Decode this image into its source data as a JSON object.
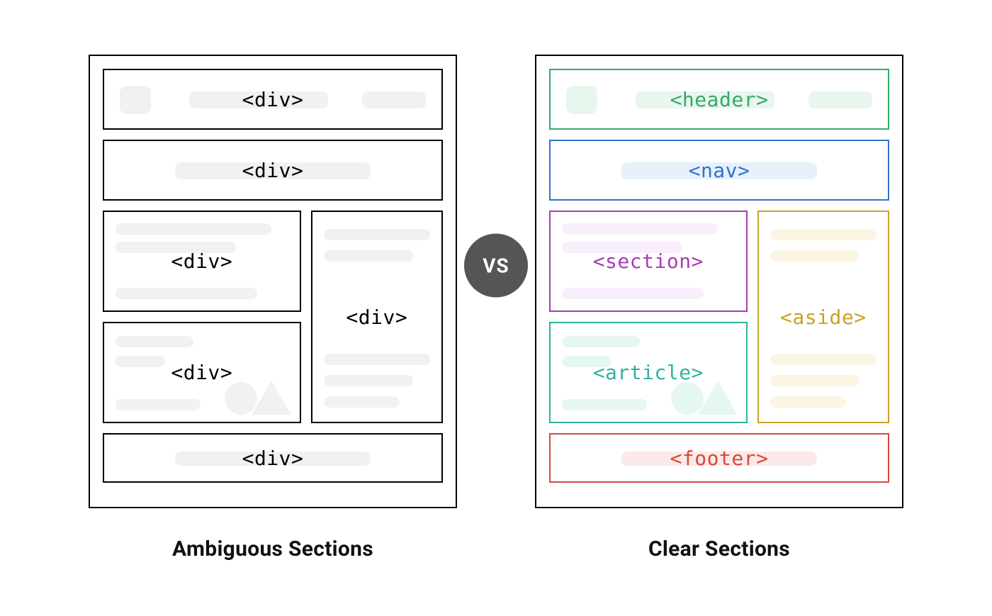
{
  "vs_label": "VS",
  "left": {
    "caption": "Ambiguous Sections",
    "boxes": {
      "header": "<div>",
      "nav": "<div>",
      "section": "<div>",
      "article": "<div>",
      "aside": "<div>",
      "footer": "<div>"
    }
  },
  "right": {
    "caption": "Clear Sections",
    "boxes": {
      "header": "<header>",
      "nav": "<nav>",
      "section": "<section>",
      "article": "<article>",
      "aside": "<aside>",
      "footer": "<footer>"
    }
  },
  "colors": {
    "header": "#34a96b",
    "nav": "#2e74d0",
    "section": "#a83cb2",
    "article": "#2fb2a0",
    "aside": "#c9a227",
    "footer": "#d9483b",
    "vs_bg": "#555555",
    "outline": "#000000",
    "skeleton": "#f1f1f1"
  }
}
